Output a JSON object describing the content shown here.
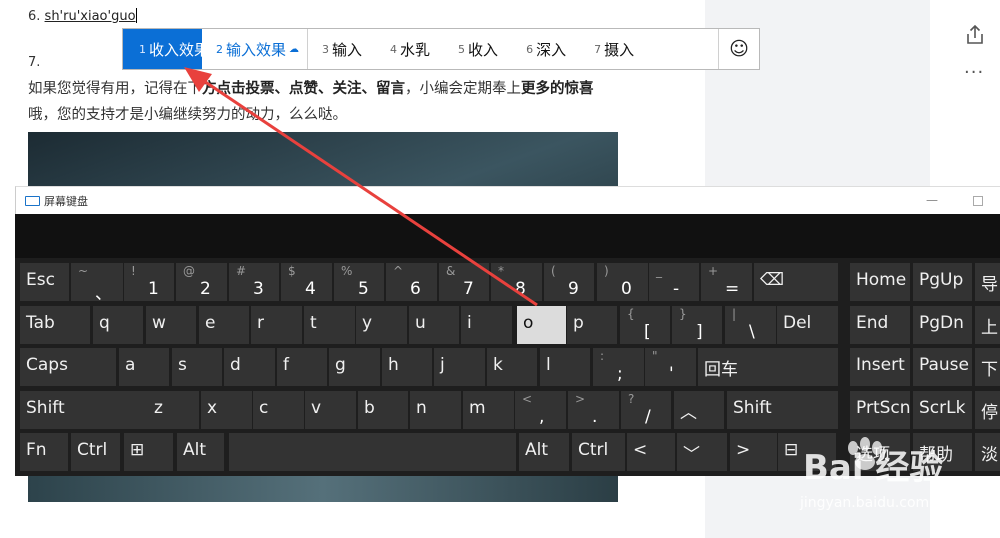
{
  "article": {
    "line6_prefix": "6.",
    "line6_typed": "sh'ru'xiao'guo",
    "line7": "7.",
    "para_1": "如果您觉得有用，记得在下",
    "para_2": "方点击投票、点赞、关注、留言",
    "para_3": "，小编会定期奉上",
    "para_4": "更多的惊喜",
    "para_5": "哦，您的支持才是小编继续努力的动力，么么哒。"
  },
  "ime": {
    "candidates": [
      {
        "num": "1",
        "text": "收入效果"
      },
      {
        "num": "2",
        "text": "输入效果"
      },
      {
        "num": "3",
        "text": "输入"
      },
      {
        "num": "4",
        "text": "水乳"
      },
      {
        "num": "5",
        "text": "收入"
      },
      {
        "num": "6",
        "text": "深入"
      },
      {
        "num": "7",
        "text": "摄入"
      }
    ],
    "emoji_glyph": "☺",
    "cloud_glyph": "☁"
  },
  "osk": {
    "title": "屏幕键盘",
    "minimize": "—",
    "rows": {
      "r1": [
        {
          "label": "Esc"
        },
        {
          "shift": "~",
          "main": "、"
        },
        {
          "shift": "!",
          "main": "1"
        },
        {
          "shift": "@",
          "main": "2"
        },
        {
          "shift": "#",
          "main": "3"
        },
        {
          "shift": "$",
          "main": "4"
        },
        {
          "shift": "%",
          "main": "5"
        },
        {
          "shift": "^",
          "main": "6"
        },
        {
          "shift": "&",
          "main": "7"
        },
        {
          "shift": "*",
          "main": "8"
        },
        {
          "shift": "(",
          "main": "9"
        },
        {
          "shift": ")",
          "main": "0"
        },
        {
          "shift": "_",
          "main": "-"
        },
        {
          "shift": "+",
          "main": "="
        },
        {
          "label": "⌫"
        }
      ],
      "r2": [
        {
          "label": "Tab"
        },
        {
          "label": "q"
        },
        {
          "label": "w"
        },
        {
          "label": "e"
        },
        {
          "label": "r"
        },
        {
          "label": "t"
        },
        {
          "label": "y"
        },
        {
          "label": "u"
        },
        {
          "label": "i"
        },
        {
          "label": "o"
        },
        {
          "label": "p"
        },
        {
          "shift": "{",
          "main": "["
        },
        {
          "shift": "}",
          "main": "]"
        },
        {
          "shift": "|",
          "main": "\\"
        },
        {
          "label": "Del"
        }
      ],
      "r3": [
        {
          "label": "Caps"
        },
        {
          "label": "a"
        },
        {
          "label": "s"
        },
        {
          "label": "d"
        },
        {
          "label": "f"
        },
        {
          "label": "g"
        },
        {
          "label": "h"
        },
        {
          "label": "j"
        },
        {
          "label": "k"
        },
        {
          "label": "l"
        },
        {
          "shift": ":",
          "main": ";"
        },
        {
          "shift": "\"",
          "main": "'"
        },
        {
          "label": "回车"
        }
      ],
      "r4": [
        {
          "label": "Shift"
        },
        {
          "label": "z"
        },
        {
          "label": "x"
        },
        {
          "label": "c"
        },
        {
          "label": "v"
        },
        {
          "label": "b"
        },
        {
          "label": "n"
        },
        {
          "label": "m"
        },
        {
          "shift": "<",
          "main": ","
        },
        {
          "shift": ">",
          "main": "."
        },
        {
          "shift": "?",
          "main": "/"
        },
        {
          "label": "︿"
        },
        {
          "label": "Shift"
        }
      ],
      "r5": [
        {
          "label": "Fn"
        },
        {
          "label": "Ctrl"
        },
        {
          "label": "⊞"
        },
        {
          "label": "Alt"
        },
        {
          "label": ""
        },
        {
          "label": "Alt"
        },
        {
          "label": "Ctrl"
        },
        {
          "label": "<"
        },
        {
          "label": "﹀"
        },
        {
          "label": ">"
        },
        {
          "label": "⊟"
        }
      ],
      "nav": [
        {
          "label": "Home"
        },
        {
          "label": "PgUp"
        },
        {
          "label": "导"
        },
        {
          "label": "End"
        },
        {
          "label": "PgDn"
        },
        {
          "label": "上"
        },
        {
          "label": "Insert"
        },
        {
          "label": "Pause"
        },
        {
          "label": "下"
        },
        {
          "label": "PrtScn"
        },
        {
          "label": "ScrLk"
        },
        {
          "label": "停"
        },
        {
          "label": "选项"
        },
        {
          "label": "帮助"
        },
        {
          "label": "淡"
        }
      ]
    }
  },
  "watermark": {
    "text": "Bai 经验",
    "sub": "jingyan.baidu.com"
  },
  "colors": {
    "ime_selected": "#0b6fd6",
    "key_bg": "#333333",
    "key_highlight": "#dcdcdc",
    "arrow": "#e8413d"
  }
}
